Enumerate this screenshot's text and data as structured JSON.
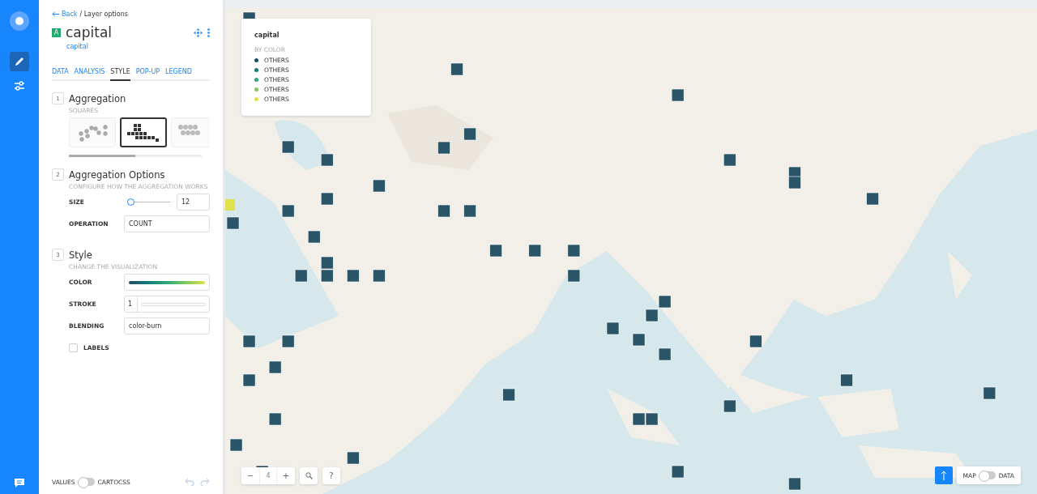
{
  "nav": {
    "items": [
      {
        "kind": "edit",
        "selected": true
      },
      {
        "kind": "settings",
        "selected": false
      }
    ]
  },
  "header": {
    "back": "Back",
    "breadcrumb": "/ Layer options",
    "badge": "A",
    "title": "capital",
    "source": "capital"
  },
  "tabs": [
    {
      "label": "DATA",
      "selected": false
    },
    {
      "label": "ANALYSIS",
      "selected": false
    },
    {
      "label": "STYLE",
      "selected": true
    },
    {
      "label": "POP-UP",
      "selected": false
    },
    {
      "label": "LEGEND",
      "selected": false
    }
  ],
  "sections": [
    {
      "number": "1",
      "title": "Aggregation",
      "subtitle": "SQUARES",
      "options": [
        {
          "kind": "points",
          "selected": false
        },
        {
          "kind": "squares",
          "selected": true
        },
        {
          "kind": "hexagons",
          "selected": false
        }
      ]
    },
    {
      "number": "2",
      "title": "Aggregation Options",
      "subtitle": "CONFIGURE HOW THE AGGREGATION WORKS",
      "fields": [
        {
          "kind": "slider",
          "label": "SIZE",
          "level": 0,
          "value": "12"
        },
        {
          "kind": "text",
          "label": "OPERATION",
          "value": "COUNT"
        }
      ]
    },
    {
      "number": "3",
      "title": "Style",
      "subtitle": "CHANGE THE VISUALIZATION",
      "fields": [
        {
          "kind": "ramp",
          "label": "COLOR"
        },
        {
          "kind": "stroke",
          "label": "STROKE",
          "value": "1"
        },
        {
          "kind": "text",
          "label": "BLENDING",
          "value": "color-burn"
        },
        {
          "kind": "checkbox",
          "label": "LABELS",
          "checked": false
        }
      ]
    }
  ],
  "footer": {
    "left_label": "VALUES",
    "right_label": "CARTOCSS",
    "on": false
  },
  "legend": {
    "title": "capital",
    "subtitle": "BY COLOR",
    "items": [
      {
        "label": "OTHERS",
        "color": "#1d4f63"
      },
      {
        "label": "OTHERS",
        "color": "#137c7a"
      },
      {
        "label": "OTHERS",
        "color": "#2fa57a"
      },
      {
        "label": "OTHERS",
        "color": "#7fc95f"
      },
      {
        "label": "OTHERS",
        "color": "#dfe24c"
      }
    ]
  },
  "zoom": {
    "minus": "−",
    "level": "4",
    "plus": "+",
    "help": "?"
  },
  "view_toggle": {
    "left": "MAP",
    "right": "DATA",
    "on": false
  }
}
